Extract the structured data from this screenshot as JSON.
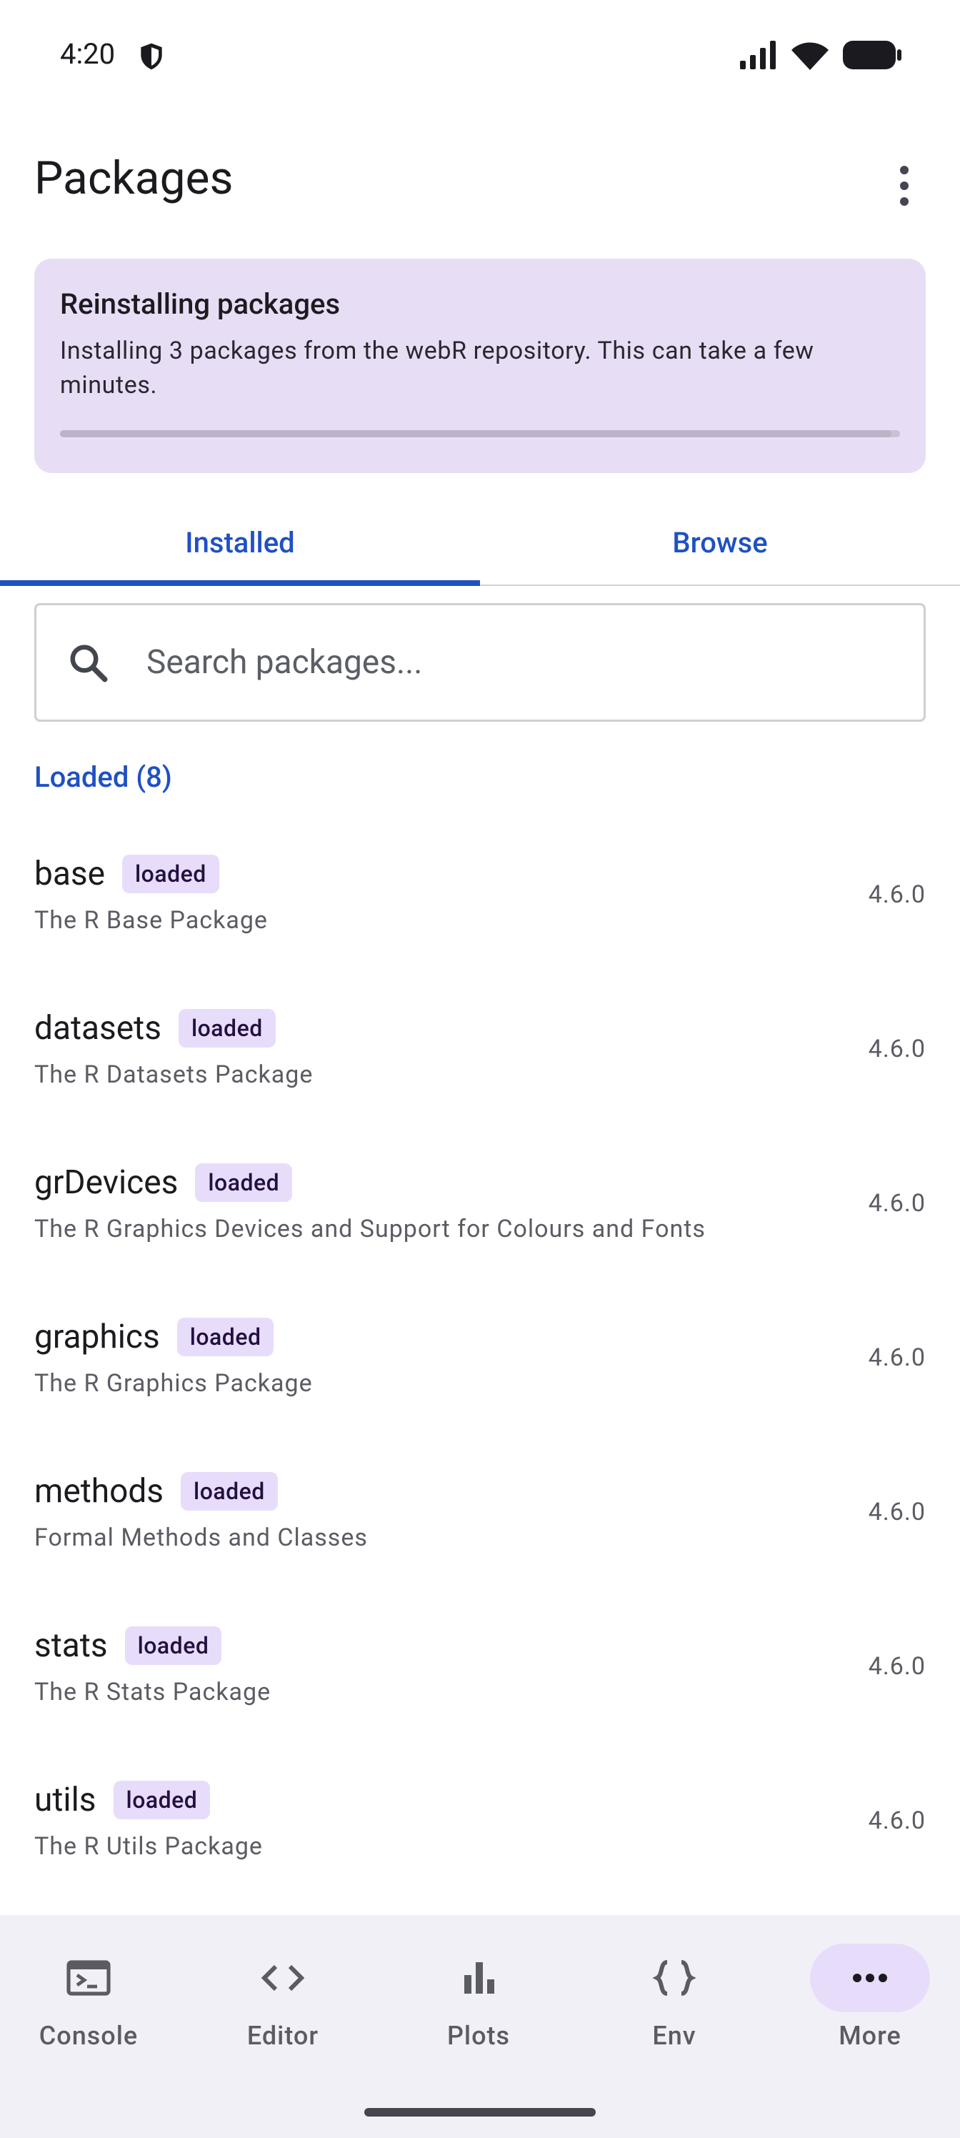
{
  "status_bar": {
    "time": "4:20"
  },
  "header": {
    "title": "Packages"
  },
  "banner": {
    "title": "Reinstalling packages",
    "message": "Installing 3 packages from the webR repository. This can take a few minutes.",
    "progress_percent": 99
  },
  "tabs": [
    {
      "label": "Installed",
      "active": true
    },
    {
      "label": "Browse",
      "active": false
    }
  ],
  "search": {
    "placeholder": "Search packages..."
  },
  "section": {
    "label": "Loaded (8)"
  },
  "packages": [
    {
      "name": "base",
      "badge": "loaded",
      "description": "The R Base Package",
      "version": "4.6.0"
    },
    {
      "name": "datasets",
      "badge": "loaded",
      "description": "The R Datasets Package",
      "version": "4.6.0"
    },
    {
      "name": "grDevices",
      "badge": "loaded",
      "description": "The R Graphics Devices and Support for Colours and Fonts",
      "version": "4.6.0"
    },
    {
      "name": "graphics",
      "badge": "loaded",
      "description": "The R Graphics Package",
      "version": "4.6.0"
    },
    {
      "name": "methods",
      "badge": "loaded",
      "description": "Formal Methods and Classes",
      "version": "4.6.0"
    },
    {
      "name": "stats",
      "badge": "loaded",
      "description": "The R Stats Package",
      "version": "4.6.0"
    },
    {
      "name": "utils",
      "badge": "loaded",
      "description": "The R Utils Package",
      "version": "4.6.0"
    }
  ],
  "bottom_nav": [
    {
      "label": "Console",
      "icon": "console-icon",
      "active": false
    },
    {
      "label": "Editor",
      "icon": "code-icon",
      "active": false
    },
    {
      "label": "Plots",
      "icon": "bar-chart-icon",
      "active": false
    },
    {
      "label": "Env",
      "icon": "braces-icon",
      "active": false
    },
    {
      "label": "More",
      "icon": "more-horizontal-icon",
      "active": true
    }
  ],
  "colors": {
    "accent": "#1f51c2",
    "banner_bg": "#e7def6",
    "badge_bg": "#e8dcfb",
    "nav_bg": "#f1f0f6"
  }
}
